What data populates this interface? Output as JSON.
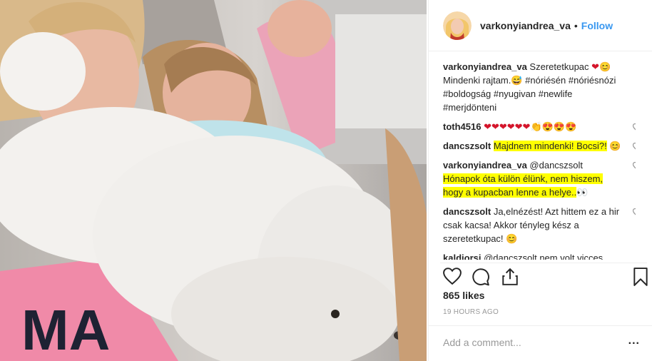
{
  "header": {
    "username": "varkonyiandrea_va",
    "separator": "•",
    "follow_label": "Follow"
  },
  "comments": [
    {
      "user": "varkonyiandrea_va",
      "parts": [
        {
          "text": "Szeretetkupac ",
          "hl": false
        },
        {
          "text": "❤",
          "hl": false,
          "cls": "red"
        },
        {
          "text": "😊",
          "hl": false,
          "cls": "emoji"
        },
        {
          "text": " Mindenki rajtam.",
          "hl": false
        },
        {
          "text": "😅",
          "hl": false,
          "cls": "emoji"
        },
        {
          "text": " #nóriésén #nóriésnózi #boldogság #nyugivan #newlife #merjdönteni",
          "hl": false
        }
      ],
      "heart": false
    },
    {
      "user": "toth4516",
      "parts": [
        {
          "text": "❤❤❤❤❤❤",
          "hl": false,
          "cls": "red"
        },
        {
          "text": "👏",
          "hl": false
        },
        {
          "text": "😍😍😍",
          "hl": false,
          "cls": "emoji"
        }
      ],
      "heart": true
    },
    {
      "user": "dancszsolt",
      "parts": [
        {
          "text": "Majdnem mindenki! Bocsi?!",
          "hl": true
        },
        {
          "text": " 😊",
          "hl": false,
          "cls": "emoji"
        }
      ],
      "heart": true
    },
    {
      "user": "varkonyiandrea_va",
      "parts": [
        {
          "text": "@dancszsolt",
          "hl": false
        },
        {
          "text": " Hónapok óta külön élünk, nem hiszem, hogy a kupacban lenne a helye..",
          "hl": true
        },
        {
          "text": "👀",
          "hl": false
        }
      ],
      "heart": true
    },
    {
      "user": "dancszsolt",
      "parts": [
        {
          "text": "Ja,elnézést! Azt hittem ez a hir csak kacsa! Akkor tényleg kész a szeretetkupac! ",
          "hl": false
        },
        {
          "text": "😊",
          "hl": false,
          "cls": "emoji"
        }
      ],
      "heart": true
    },
    {
      "user": "kaldiorsi",
      "parts": [
        {
          "text": "@dancszsolt nem volt vicces",
          "hl": false
        }
      ],
      "heart": false
    }
  ],
  "icons": {
    "like": "heart-icon",
    "comment": "comment-icon",
    "share": "share-icon",
    "save": "bookmark-icon",
    "comment_like": "heart-outline-icon",
    "more": "more-options-icon"
  },
  "likes": "865 likes",
  "timestamp": "19 HOURS AGO",
  "add_comment": {
    "placeholder": "Add a comment...",
    "more_label": "..."
  },
  "colors": {
    "link": "#3897f0",
    "text": "#262626",
    "muted": "#999999",
    "highlight": "#ffff00"
  }
}
